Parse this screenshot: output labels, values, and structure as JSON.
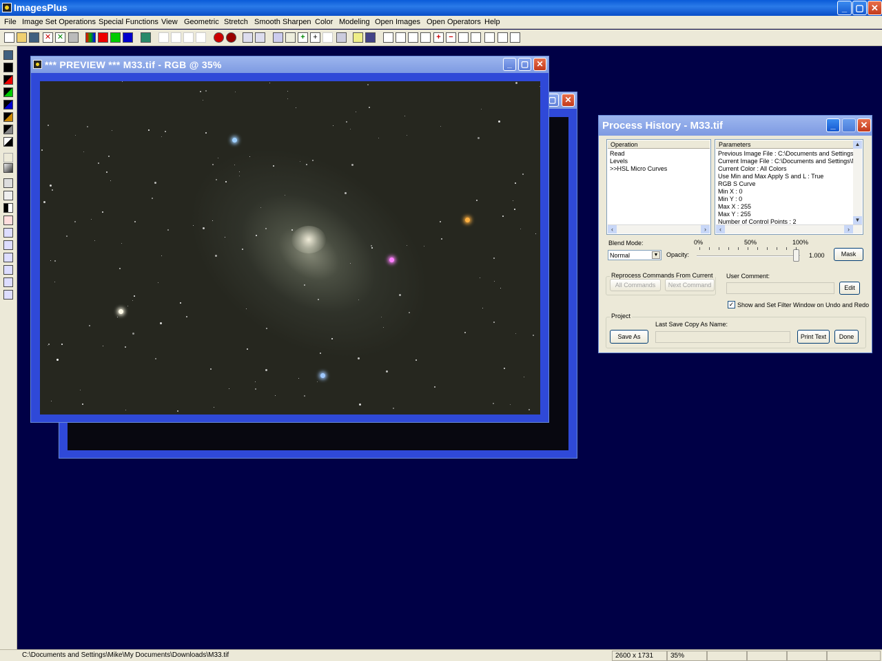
{
  "app": {
    "title": "ImagesPlus"
  },
  "menu": [
    "File",
    "Image Set Operations",
    "Special Functions",
    "View",
    "Geometric",
    "Stretch",
    "Smooth Sharpen",
    "Color",
    "Modeling",
    "Open Images",
    "Open Operators",
    "Help"
  ],
  "preview_window": {
    "title": "*** PREVIEW *** M33.tif - RGB @ 35%"
  },
  "history": {
    "title": "Process History - M33.tif",
    "operation_header": "Operation",
    "operations": [
      "Read",
      "Levels",
      ">>HSL Micro Curves"
    ],
    "parameters_header": "Parameters",
    "parameters": [
      "Previous Image File : C:\\Documents and Settings\\M",
      "Current Image File : C:\\Documents and Settings\\Mik",
      "Current Color : All Colors",
      "Use Min and Max Apply S and L : True",
      "RGB S Curve",
      " Min X : 0",
      " Min Y : 0",
      " Max X : 255",
      " Max Y : 255",
      " Number of Control Points : 2"
    ],
    "blend_mode_label": "Blend Mode:",
    "blend_mode_value": "Normal",
    "opacity_label": "Opacity:",
    "opacity_ticks": [
      "0%",
      "50%",
      "100%"
    ],
    "opacity_value": "1.000",
    "opacity_fraction": 1.0,
    "mask_button": "Mask",
    "reprocess_group": "Reprocess Commands From Current >>",
    "all_commands_button": "All Commands",
    "next_command_button": "Next Command",
    "user_comment_label": "User Comment:",
    "edit_button": "Edit",
    "show_filter_label": "Show and Set Filter Window on Undo and Redo",
    "show_filter_checked": true,
    "project_group": "Project",
    "last_save_label": "Last Save Copy As Name:",
    "save_as_button": "Save As",
    "print_text_button": "Print Text",
    "done_button": "Done"
  },
  "status": {
    "path": "C:\\Documents and Settings\\Mike\\My Documents\\Downloads\\M33.tif",
    "dimensions": "2600 x 1731",
    "zoom": "35%"
  }
}
